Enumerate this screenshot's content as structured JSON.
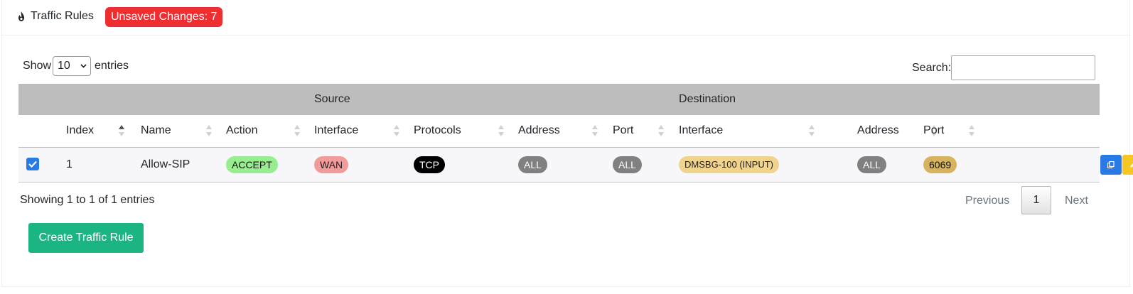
{
  "header": {
    "title": "Traffic Rules",
    "unsaved_badge": "Unsaved Changes: 7",
    "icon": "fire-icon"
  },
  "length_menu": {
    "show_label": "Show",
    "selected": "10",
    "entries_label": "entries"
  },
  "search": {
    "label": "Search:",
    "value": ""
  },
  "table": {
    "group_headers": {
      "source": "Source",
      "destination": "Destination"
    },
    "columns": [
      "Index",
      "Name",
      "Action",
      "Interface",
      "Protocols",
      "Address",
      "Port",
      "Interface",
      "Address",
      "Port"
    ],
    "rows": [
      {
        "checked": true,
        "index": "1",
        "name": "Allow-SIP",
        "action": "ACCEPT",
        "src_interface": "WAN",
        "protocols": "TCP",
        "src_address": "ALL",
        "src_port": "ALL",
        "dst_interface": "DMSBG-100 (INPUT)",
        "dst_address": "ALL",
        "dst_port": "6069"
      }
    ]
  },
  "pagination": {
    "info": "Showing 1 to 1 of 1 entries",
    "previous": "Previous",
    "current_page": "1",
    "next": "Next"
  },
  "create_button": "Create Traffic Rule",
  "colors": {
    "unsaved_badge": "#ee2e31",
    "accept": "#97ee8f",
    "wan": "#f39a9a",
    "tcp": "#000000",
    "all": "#808080",
    "dst_interface": "#f0d48e",
    "dst_port": "#d6b35c",
    "copy_button": "#2a7ae6",
    "edit_button": "#f6c624",
    "delete_button": "#ee3b3b",
    "create_button": "#1bb584"
  }
}
